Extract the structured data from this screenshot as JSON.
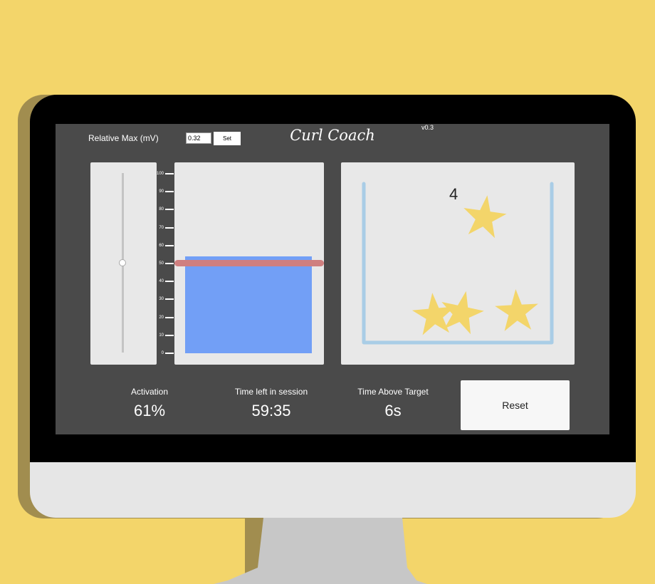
{
  "app": {
    "title": "Curl Coach",
    "version": "v0.3"
  },
  "controls": {
    "relative_max_label": "Relative Max (mV)",
    "relative_max_value": "0.32",
    "set_label": "Set"
  },
  "gauge": {
    "ticks": [
      "100",
      "90",
      "80",
      "70",
      "60",
      "50",
      "40",
      "30",
      "20",
      "10",
      "0"
    ],
    "activation_fraction": 0.54,
    "target_fraction": 0.5,
    "slider_fraction": 0.5
  },
  "stars": {
    "count": "4",
    "color": "#f3d56a"
  },
  "stats": {
    "activation_label": "Activation",
    "activation_value": "61%",
    "time_left_label": "Time left in session",
    "time_left_value": "59:35",
    "time_above_label": "Time Above Target",
    "time_above_value": "6s"
  },
  "reset_label": "Reset",
  "colors": {
    "background": "#f3d56a",
    "screen": "#4a4a4a",
    "activation_bar": "#729ff6",
    "target_line": "#cf7f7f",
    "jar": "#a9cde6"
  }
}
